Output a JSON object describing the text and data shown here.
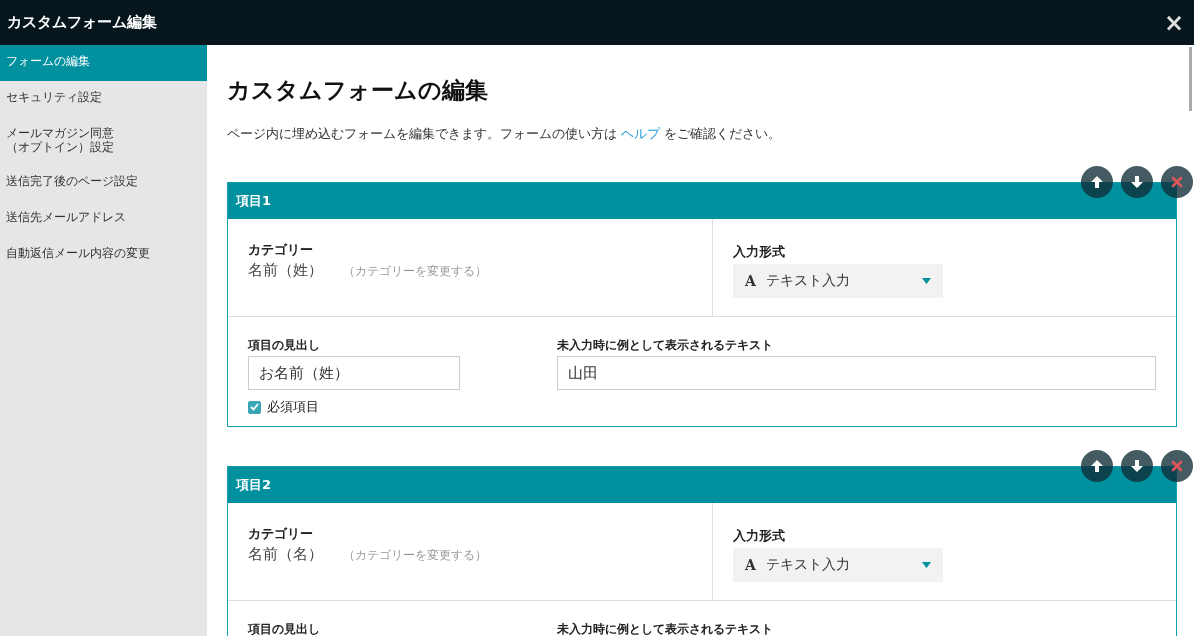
{
  "window": {
    "title": "カスタムフォーム編集",
    "close": "×"
  },
  "sidebar": {
    "items": [
      {
        "label": "フォームの編集",
        "selected": true
      },
      {
        "label": "セキュリティ設定",
        "selected": false
      },
      {
        "label_lines": [
          "メールマガジン同意",
          "（オプトイン）設定"
        ],
        "selected": false
      },
      {
        "label": "送信完了後のページ設定",
        "selected": false
      },
      {
        "label": "送信先メールアドレス",
        "selected": false
      },
      {
        "label": "自動返信メール内容の変更",
        "selected": false
      }
    ]
  },
  "page": {
    "title": "カスタムフォームの編集",
    "description_before": "ページ内に埋め込むフォームを編集できます。フォームの使い方は",
    "help_link": "ヘルプ",
    "description_after": "をご確認ください。"
  },
  "items": [
    {
      "title": "項目1",
      "category_label": "カテゴリー",
      "category_value": "名前（姓）",
      "change_link": "（カテゴリーを変更する）",
      "input_type_label": "入力形式",
      "input_type_glyph": "A",
      "input_type_value": "テキスト入力",
      "heading_field": {
        "label": "項目の見出し",
        "value": "お名前（姓）"
      },
      "example_field": {
        "label": "未入力時に例として表示されるテキスト",
        "value": "山田"
      },
      "required_label": "必須項目",
      "required": true
    },
    {
      "title": "項目2",
      "category_label": "カテゴリー",
      "category_value": "名前（名）",
      "change_link": "（カテゴリーを変更する）",
      "input_type_label": "入力形式",
      "input_type_glyph": "A",
      "input_type_value": "テキスト入力",
      "heading_field": {
        "label": "項目の見出し"
      },
      "example_field": {
        "label": "未入力時に例として表示されるテキスト"
      }
    }
  ]
}
